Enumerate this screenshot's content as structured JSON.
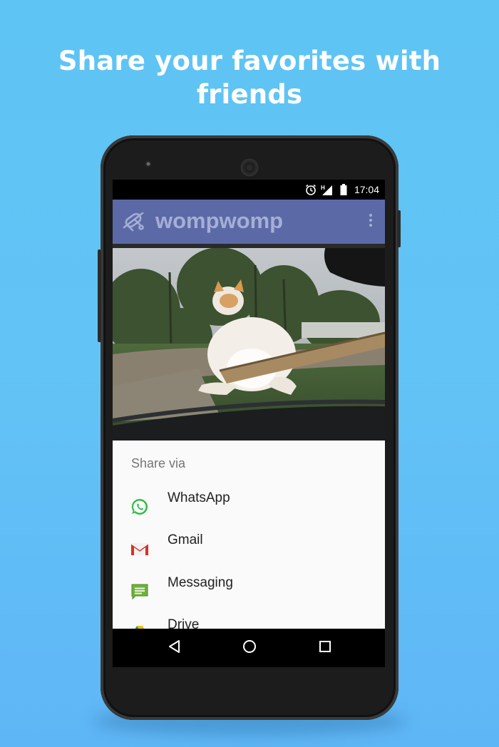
{
  "headline": {
    "line1": "Share your favorites with",
    "line2": "friends"
  },
  "status_bar": {
    "time": "17:04",
    "icons": [
      "alarm-icon",
      "signal-icon",
      "battery-icon"
    ]
  },
  "app_bar": {
    "title": "wompwomp",
    "logo": "app-logo-icon",
    "menu": "overflow-menu-icon"
  },
  "share_sheet": {
    "title": "Share via",
    "items": [
      {
        "label": "WhatsApp",
        "icon": "whatsapp-icon"
      },
      {
        "label": "Gmail",
        "icon": "gmail-icon"
      },
      {
        "label": "Messaging",
        "icon": "messaging-icon"
      },
      {
        "label": "Drive",
        "icon": "drive-icon"
      }
    ]
  },
  "nav_bar": {
    "buttons": [
      "back-icon",
      "home-icon",
      "recents-icon"
    ]
  },
  "colors": {
    "background": "#5ec4f3",
    "app_bar": "#5b6aa6",
    "app_title": "#a6aed6",
    "sheet": "#fafafa"
  }
}
